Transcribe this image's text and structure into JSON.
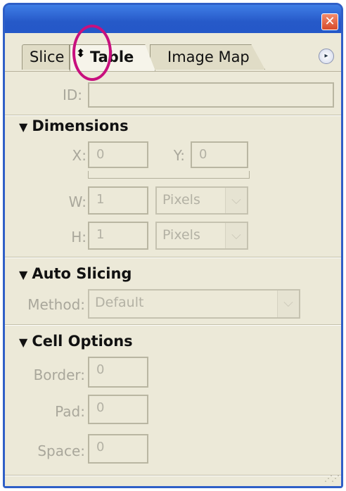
{
  "window": {
    "close_glyph": "✕"
  },
  "tabs": [
    {
      "label": "Slice"
    },
    {
      "label": "Table",
      "icon": "up-down-arrows-icon",
      "icon_glyph": "⬍"
    },
    {
      "label": "Image Map"
    }
  ],
  "menu_glyph": "▸",
  "id_field": {
    "label": "ID:",
    "value": ""
  },
  "dimensions": {
    "title": "Dimensions",
    "x_label": "X:",
    "x_value": "0",
    "y_label": "Y:",
    "y_value": "0",
    "w_label": "W:",
    "w_value": "1",
    "w_unit": "Pixels",
    "h_label": "H:",
    "h_value": "1",
    "h_unit": "Pixels"
  },
  "auto_slicing": {
    "title": "Auto Slicing",
    "method_label": "Method:",
    "method_value": "Default"
  },
  "cell_options": {
    "title": "Cell Options",
    "border_label": "Border:",
    "border_value": "0",
    "pad_label": "Pad:",
    "pad_value": "0",
    "space_label": "Space:",
    "space_value": "0"
  },
  "colors": {
    "titlebar": "#2659c8",
    "annotation": "#c8107e",
    "panel": "#ece9d8"
  }
}
